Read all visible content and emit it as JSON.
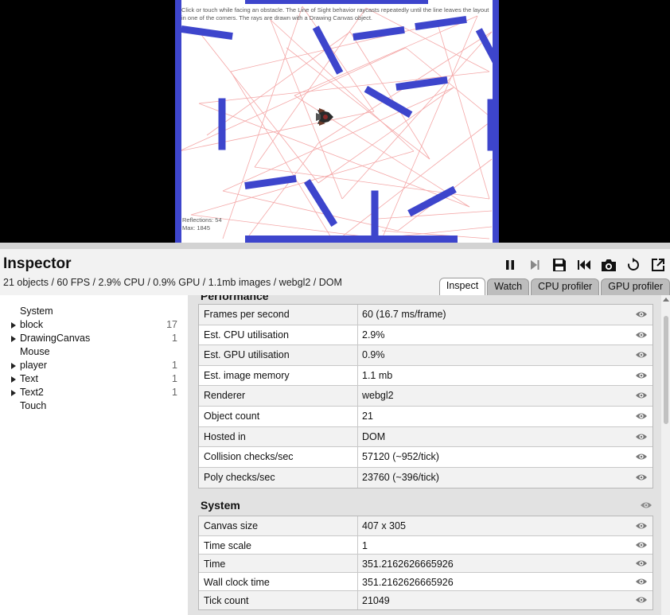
{
  "game": {
    "instructions": "Click or touch while facing an obstacle. The Line of Sight behavior raycasts repeatedly until the line leaves the layout in one of the corners. The rays are drawn with a Drawing Canvas object.",
    "reflections": "Reflections: 54",
    "max": "Max: 1845",
    "colors": {
      "block": "#3d45cc",
      "ray": "#f4a7a7",
      "background": "#ffffff"
    }
  },
  "inspector": {
    "title": "Inspector",
    "stats": "21 objects / 60 FPS / 2.9% CPU / 0.9% GPU / 1.1mb images / webgl2 / DOM",
    "toolbar": [
      {
        "name": "pause-icon"
      },
      {
        "name": "step-icon"
      },
      {
        "name": "save-icon"
      },
      {
        "name": "rewind-icon"
      },
      {
        "name": "camera-icon"
      },
      {
        "name": "restart-icon"
      },
      {
        "name": "popout-icon"
      }
    ],
    "tabs": [
      {
        "label": "Inspect",
        "active": true
      },
      {
        "label": "Watch",
        "active": false
      },
      {
        "label": "CPU profiler",
        "active": false
      },
      {
        "label": "GPU profiler",
        "active": false
      }
    ]
  },
  "tree": [
    {
      "label": "System",
      "count": "",
      "expandable": false
    },
    {
      "label": "block",
      "count": "17",
      "expandable": true
    },
    {
      "label": "DrawingCanvas",
      "count": "1",
      "expandable": true
    },
    {
      "label": "Mouse",
      "count": "",
      "expandable": false
    },
    {
      "label": "player",
      "count": "1",
      "expandable": true
    },
    {
      "label": "Text",
      "count": "1",
      "expandable": true
    },
    {
      "label": "Text2",
      "count": "1",
      "expandable": true
    },
    {
      "label": "Touch",
      "count": "",
      "expandable": false
    }
  ],
  "sections": [
    {
      "title": "Performance",
      "rows": [
        {
          "name": "Frames per second",
          "value": "60 (16.7 ms/frame)"
        },
        {
          "name": "Est. CPU utilisation",
          "value": "2.9%"
        },
        {
          "name": "Est. GPU utilisation",
          "value": "0.9%"
        },
        {
          "name": "Est. image memory",
          "value": "1.1 mb"
        },
        {
          "name": "Renderer",
          "value": "webgl2"
        },
        {
          "name": "Object count",
          "value": "21"
        },
        {
          "name": "Hosted in",
          "value": "DOM"
        },
        {
          "name": "Collision checks/sec",
          "value": "57120 (~952/tick)"
        },
        {
          "name": "Poly checks/sec",
          "value": "23760 (~396/tick)"
        }
      ]
    },
    {
      "title": "System",
      "rows": [
        {
          "name": "Canvas size",
          "value": "407 x 305"
        },
        {
          "name": "Time scale",
          "value": "1"
        },
        {
          "name": "Time",
          "value": "351.2162626665926"
        },
        {
          "name": "Wall clock time",
          "value": "351.2162626665926"
        },
        {
          "name": "Tick count",
          "value": "21049"
        }
      ]
    }
  ]
}
